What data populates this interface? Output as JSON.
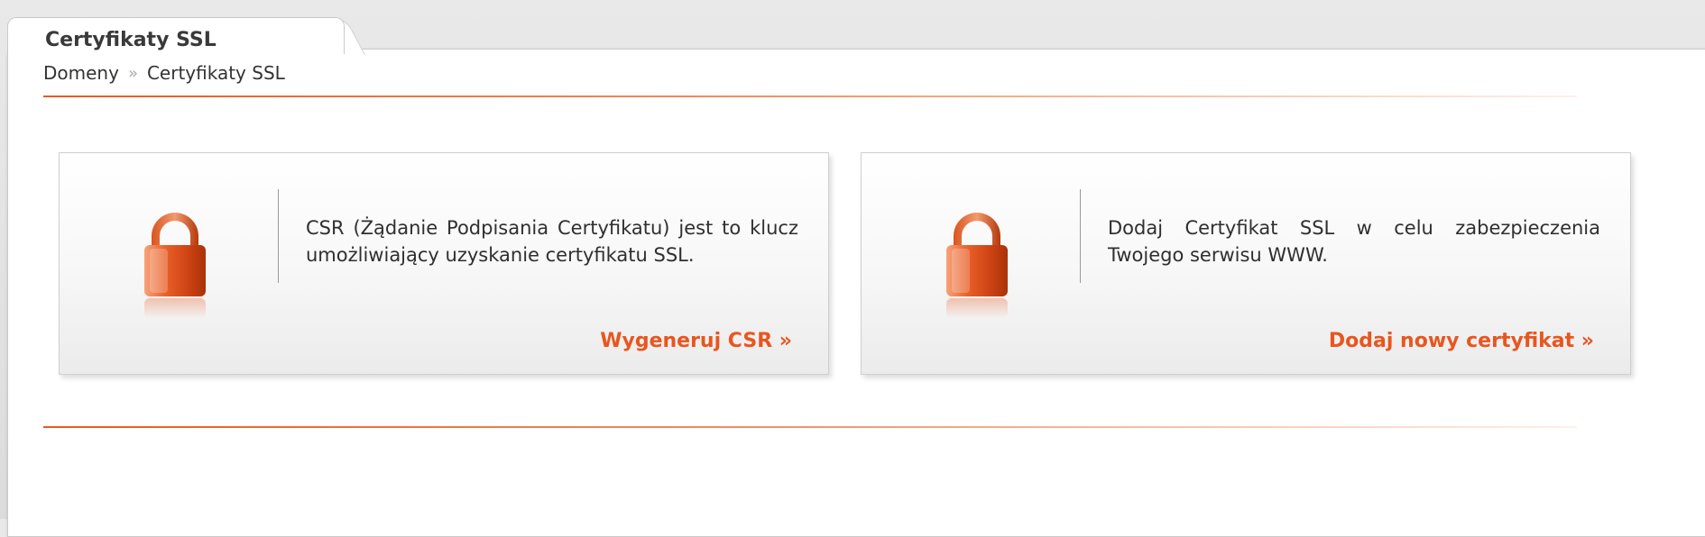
{
  "page": {
    "tab_title": "Certyfikaty SSL"
  },
  "breadcrumb": {
    "items": [
      "Domeny",
      "Certyfikaty SSL"
    ],
    "separator": "»"
  },
  "cards": [
    {
      "icon": "padlock-icon",
      "description": "CSR (Żądanie Podpisania Certyfikatu) jest to klucz umożliwiający uzyskanie certyfikatu SSL.",
      "action_label": "Wygeneruj CSR »"
    },
    {
      "icon": "padlock-icon",
      "description": "Dodaj Certyfikat SSL w celu zabezpieczenia Twojego serwisu WWW.",
      "action_label": "Dodaj nowy certyfikat »"
    }
  ],
  "colors": {
    "accent": "#e8561f",
    "text": "#333333",
    "separator": "#a8a8a8"
  }
}
